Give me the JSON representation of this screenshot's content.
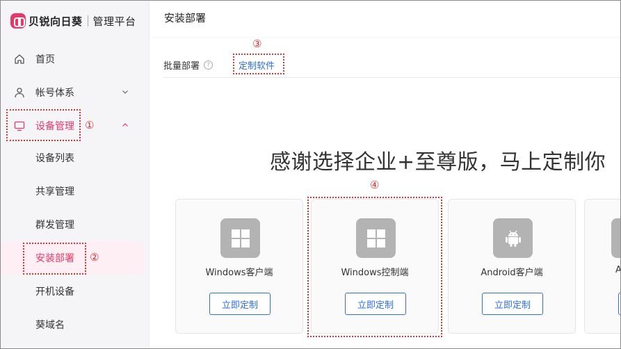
{
  "brand": {
    "name": "贝锐向日葵",
    "subtitle": "管理平台"
  },
  "sidebar": {
    "items": [
      {
        "label": "首页",
        "icon": "home-icon"
      },
      {
        "label": "帐号体系",
        "icon": "user-icon",
        "chevron": "chevron-down-icon"
      },
      {
        "label": "设备管理",
        "icon": "monitor-icon",
        "chevron": "chevron-up-icon"
      }
    ],
    "sub_items": [
      {
        "label": "设备列表"
      },
      {
        "label": "共享管理"
      },
      {
        "label": "群发管理"
      },
      {
        "label": "安装部署",
        "selected": true
      },
      {
        "label": "开机设备"
      },
      {
        "label": "葵域名"
      }
    ]
  },
  "header": {
    "title": "安装部署"
  },
  "tabs": [
    {
      "label": "批量部署"
    },
    {
      "label": "定制软件",
      "active": true
    }
  ],
  "hero": {
    "text": "感谢选择企业+至尊版，马上定制你"
  },
  "cards": [
    {
      "name": "Windows客户端",
      "button": "立即定制",
      "icon": "windows-icon"
    },
    {
      "name": "Windows控制端",
      "button": "立即定制",
      "icon": "windows-icon"
    },
    {
      "name": "Android客户端",
      "button": "立即定制",
      "icon": "android-icon"
    },
    {
      "name": "A",
      "button": "",
      "icon": ""
    }
  ],
  "annotations": [
    "①",
    "②",
    "③",
    "④"
  ],
  "colors": {
    "brand": "#e8386a",
    "link": "#2f6de0",
    "annotation": "#e03030"
  }
}
